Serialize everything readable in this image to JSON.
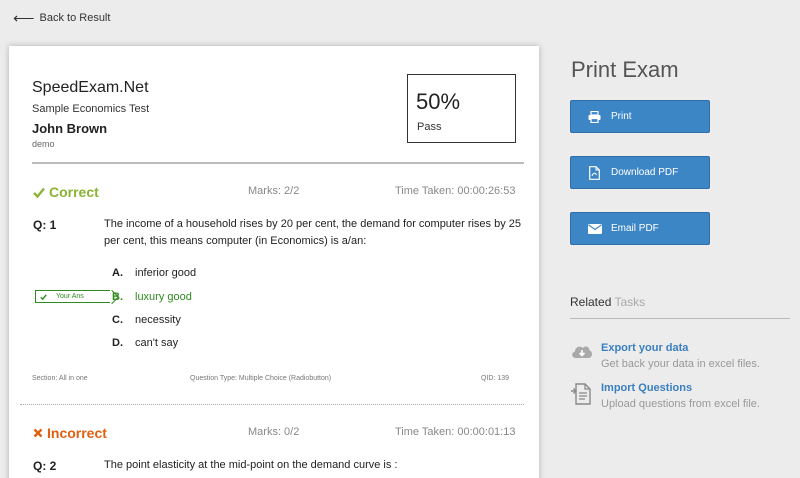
{
  "nav": {
    "back_label": "Back to Result"
  },
  "header": {
    "org_name": "SpeedExam.Net",
    "test_name": "Sample Economics Test",
    "candidate_name": "John Brown",
    "username": "demo",
    "score_percent": "50%",
    "result_status": "Pass"
  },
  "questions": [
    {
      "status_label": "Correct",
      "status_icon": "check-icon",
      "marks": "Marks: 2/2",
      "time_taken": "Time Taken: 00:00:26:53",
      "number": "Q: 1",
      "text": "The income of a household rises by 20 per cent, the demand for computer rises by 25 per cent, this means computer (in Economics) is a/an:",
      "your_answer_label": "Your Ans",
      "options": [
        {
          "letter": "A.",
          "text": "inferior good"
        },
        {
          "letter": "B.",
          "text": "luxury good"
        },
        {
          "letter": "C.",
          "text": "necessity"
        },
        {
          "letter": "D.",
          "text": "can't say"
        }
      ],
      "section": "Section: All in one",
      "question_type": "Question Type: Multiple Choice (Radiobutton)",
      "qid": "QID: 139"
    },
    {
      "status_label": "Incorrect",
      "status_icon": "cross-icon",
      "marks": "Marks: 0/2",
      "time_taken": "Time Taken: 00:00:01:13",
      "number": "Q: 2",
      "text": "The point elasticity at the mid-point on the demand curve is :"
    }
  ],
  "sidebar": {
    "title": "Print Exam",
    "buttons": {
      "print": "Print",
      "download_pdf": "Download PDF",
      "email_pdf": "Email PDF"
    },
    "related": {
      "title_main": "Related",
      "title_muted": "Tasks",
      "tasks": [
        {
          "icon": "cloud-download-icon",
          "title": "Export your data",
          "desc": "Get back your data in excel files."
        },
        {
          "icon": "import-document-icon",
          "title": "Import Questions",
          "desc": "Upload questions from excel file."
        }
      ]
    }
  },
  "colors": {
    "background": "#ececec",
    "primary_button": "#3d86c6",
    "correct": "#8ab433",
    "incorrect": "#e06010",
    "selected_answer": "#2e8b1e",
    "link": "#3a7fc0"
  }
}
